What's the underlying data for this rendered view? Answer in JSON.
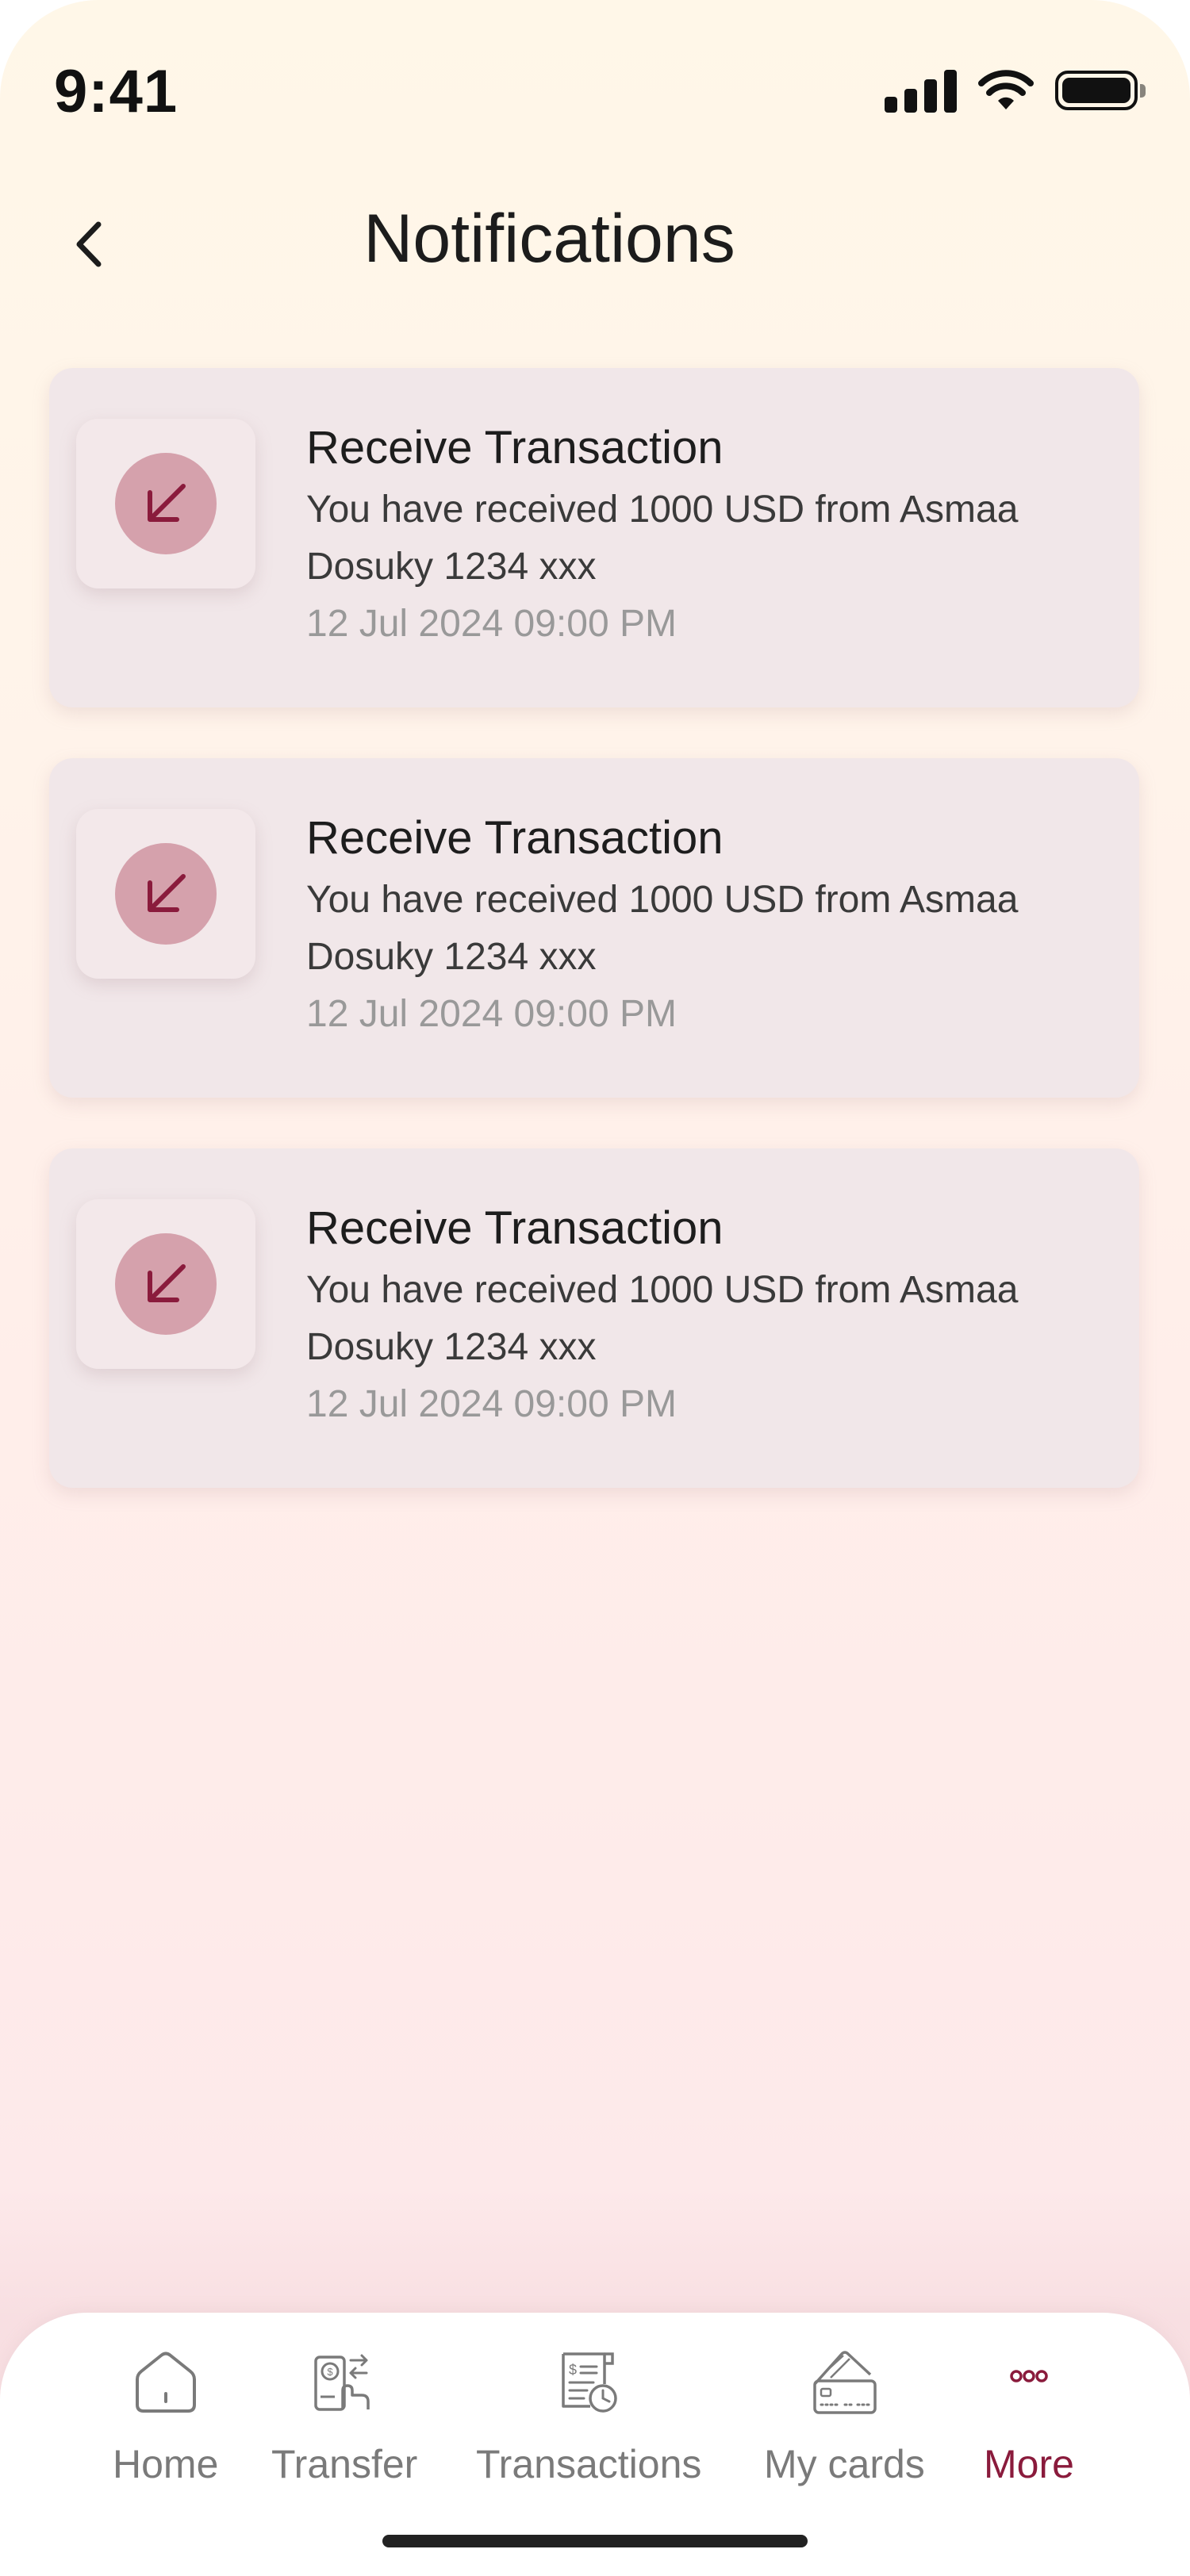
{
  "status_bar": {
    "time": "9:41"
  },
  "header": {
    "title": "Notifications"
  },
  "notifications": [
    {
      "title": "Receive Transaction",
      "body": "You have received 1000 USD from Asmaa Dosuky 1234 xxx",
      "time": "12 Jul 2024 09:00 PM",
      "icon": "arrow-down-left-icon"
    },
    {
      "title": "Receive Transaction",
      "body": "You have received 1000 USD from Asmaa Dosuky 1234 xxx",
      "time": "12 Jul 2024 09:00 PM",
      "icon": "arrow-down-left-icon"
    },
    {
      "title": "Receive Transaction",
      "body": "You have received 1000 USD from Asmaa Dosuky 1234 xxx",
      "time": "12 Jul 2024 09:00 PM",
      "icon": "arrow-down-left-icon"
    }
  ],
  "bottom_nav": {
    "items": [
      {
        "label": "Home",
        "icon": "home-icon"
      },
      {
        "label": "Transfer",
        "icon": "transfer-icon"
      },
      {
        "label": "Transactions",
        "icon": "receipt-clock-icon"
      },
      {
        "label": "My cards",
        "icon": "cards-icon"
      },
      {
        "label": "More",
        "icon": "more-dots-icon"
      }
    ],
    "active": "More"
  },
  "colors": {
    "accent": "#8a1b3c",
    "icon_circle": "#d5a1ac",
    "card_bg": "#f1e7e9",
    "nav_inactive": "#7a7a7a"
  }
}
